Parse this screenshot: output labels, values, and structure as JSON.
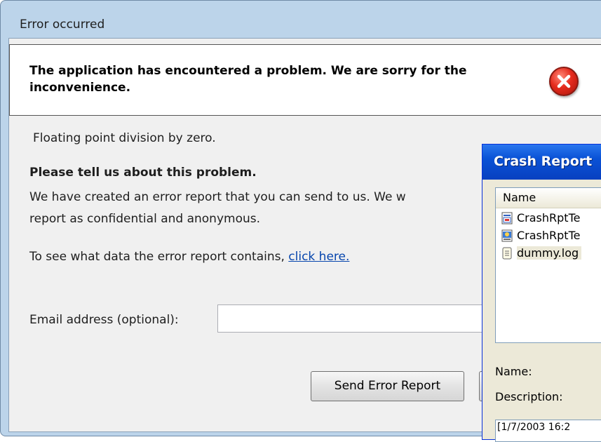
{
  "main_dialog": {
    "title": "Error occurred",
    "header": "The application has encountered a problem. We are sorry for the inconvenience.",
    "error_message": "Floating point division by zero.",
    "prompt_heading": "Please tell us about this problem.",
    "explanation_line1": "We have created an error report that you can send to us. We w",
    "explanation_line2": "report as confidential and anonymous.",
    "see_data_text": "To see what data the error report contains,",
    "see_data_link": "click here.",
    "email_label": "Email address (optional):",
    "email_value": "",
    "send_button": "Send Error Report"
  },
  "crash_window": {
    "title": "Crash Report",
    "column_header": "Name",
    "files": [
      {
        "name": "CrashRptTe",
        "icon": "xml-file-icon"
      },
      {
        "name": "CrashRptTe",
        "icon": "image-file-icon"
      },
      {
        "name": "dummy.log",
        "icon": "text-file-icon"
      }
    ],
    "name_label": "Name:",
    "description_label": "Description:",
    "log_text": "[1/7/2003 16:2"
  },
  "colors": {
    "frame": "#bcd4ea",
    "client": "#f0f0f0",
    "link": "#0645ad",
    "error_red": "#e52b1d",
    "xp_title": "#0a52d6"
  }
}
